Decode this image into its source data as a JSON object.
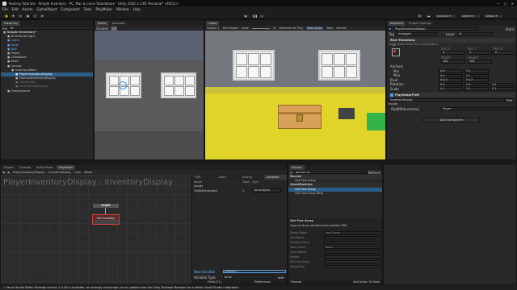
{
  "window": {
    "title": "Hutong Tutorials - Simple Inventory - PC, Mac & Linux Standalone - Unity 2020.3.13f1 Personal* <DX11>"
  },
  "menu": [
    "File",
    "Edit",
    "Assets",
    "GameObject",
    "Component",
    "Tools",
    "PlayMaker",
    "Window",
    "Help"
  ],
  "toolbar": {
    "account": "Account",
    "layers": "Layers",
    "layout": "Layout"
  },
  "hierarchy": {
    "tab": "Hierarchy",
    "search_placeholder": "All",
    "rows": [
      {
        "label": "Simple Inventory*",
        "depth": 0,
        "style": "bold"
      },
      {
        "label": "Directional Light",
        "depth": 1,
        "style": ""
      },
      {
        "label": "Clone",
        "depth": 1,
        "style": "blue"
      },
      {
        "label": "Table",
        "depth": 1,
        "style": "blue"
      },
      {
        "label": "Doll",
        "depth": 1,
        "style": "blue"
      },
      {
        "label": "Player",
        "depth": 1,
        "style": ""
      },
      {
        "label": "ChestBase",
        "depth": 1,
        "style": ""
      },
      {
        "label": "Walls",
        "depth": 1,
        "style": ""
      },
      {
        "label": "Canvas",
        "depth": 1,
        "style": ""
      },
      {
        "label": "InventoryMenu",
        "depth": 2,
        "style": ""
      },
      {
        "label": "PlayerInventoryDisplay",
        "depth": 3,
        "style": "sel"
      },
      {
        "label": "ExternalInventoryDisplay",
        "depth": 3,
        "style": ""
      },
      {
        "label": "Placeholder",
        "depth": 3,
        "style": "dim"
      },
      {
        "label": "SecondHandDisplay",
        "depth": 3,
        "style": "dim"
      },
      {
        "label": "EventSystem",
        "depth": 1,
        "style": ""
      }
    ]
  },
  "scene": {
    "tabs": [
      "Scene",
      "Animator"
    ],
    "shading": "Shaded",
    "mode": "2D"
  },
  "game": {
    "tab": "Game",
    "display": "Display 1",
    "aspect": "16:9 Aspect",
    "scale": "Scale",
    "scale_value": "1x",
    "options": [
      "Maximize On Play",
      "Mute Audio",
      "Stats",
      "Gizmos"
    ]
  },
  "inspector": {
    "tabs": [
      "Inspector",
      "Project Settings"
    ],
    "object_name": "PlayerInventoryDisplay",
    "static": "Static",
    "tag_label": "Tag",
    "tag": "Untagged",
    "layer_label": "Layer",
    "layer": "UI",
    "rect_transform": "Rect Transform",
    "driven_note": "Some values driven by InventoryMenu.",
    "anchor_mode": "left",
    "pos_labels": [
      "Pos X",
      "Pos Y",
      "Pos Z"
    ],
    "pos_values": [
      "0",
      "0",
      "0"
    ],
    "size_labels": [
      "Width",
      "Height"
    ],
    "size_values": [
      "100",
      "100"
    ],
    "anchors": "Anchors",
    "min_label": "Min",
    "min_values": [
      "X 0",
      "Y 1"
    ],
    "max_label": "Max",
    "max_values": [
      "X 0",
      "Y 1"
    ],
    "pivot_label": "Pivot",
    "pivot_values": [
      "X 0.5",
      "Y 0.5"
    ],
    "rotation_label": "Rotation",
    "rotation_values": [
      "X 0",
      "Y 0",
      "Z 0"
    ],
    "scale_label": "Scale",
    "scale_values": [
      "X 1",
      "Y 1",
      "Z 1"
    ],
    "fsm_header": "PlayMakerFSM",
    "fsm_name": "InventoryDisplay",
    "edit": "Edit",
    "inputs": "Inputs",
    "obj_inventory_label": "ObjWithInventory",
    "obj_inventory_value": "Player",
    "add_component": "Add Component"
  },
  "bottom_tabs": [
    "Project",
    "Console",
    "Audio Mixer",
    "PlayMaker"
  ],
  "playmaker": {
    "breadcrumb": [
      "PlayerInventoryDisplay",
      "InventoryDisplay",
      "Lock",
      "Select"
    ],
    "title": "PlayerInventoryDisplay : InventoryDisplay",
    "start": "START",
    "state": "Get Inventory",
    "panel_tabs": [
      "FSM",
      "State",
      "Events",
      "Variables"
    ],
    "var_headers": [
      "Name",
      "Used",
      "Type"
    ],
    "var_groups": [
      "Inputs"
    ],
    "vars": [
      {
        "name": "ObjWithInventory",
        "used": "1",
        "type": "GameObject"
      }
    ],
    "new_variable_label": "New Variable",
    "new_variable_value": "inventory",
    "variable_type_label": "Variable Type",
    "variable_type_value": "Array",
    "add": "Add",
    "bottom": [
      "Hints [F1]",
      "Preferences"
    ]
  },
  "actions": {
    "tab": "Actions",
    "search": "get fsm arr",
    "refresh": "Refresh",
    "sections": [
      {
        "header": "Recent",
        "items": [
          "Get Fsm Array"
        ]
      },
      {
        "header": "StateMachine",
        "items": [
          "Get Fsm Array",
          "Get Fsm Array Item"
        ]
      }
    ],
    "selected": "Get Fsm Array",
    "detail_title": "Get Fsm Array",
    "detail_desc": "Copy an Array Variable from another FSM.",
    "detail_fields": [
      {
        "label": "Game Object",
        "value": "Use Owner"
      },
      {
        "label": "Fsm Name",
        "value": ""
      },
      {
        "label": "Variable Name",
        "value": ""
      },
      {
        "label": "Store Value",
        "value": "None"
      },
      {
        "label": "Copy Values",
        "value": ""
      },
      {
        "label": "Enable",
        "value": ""
      },
      {
        "label": "Get Fsm Array",
        "value": ""
      },
      {
        "label": "Everything",
        "value": ""
      }
    ],
    "preview": "Preview",
    "add_to_state": "Add Action To State"
  },
  "status": {
    "text": "Visual Studio Editor Package version 2.0.16 is available, we strongly encourage you to update from the Unity Package Manager for a better Visual Studio integration"
  },
  "colors": {
    "selection": "#2c5d87",
    "accent": "#4f9de8",
    "error": "#d04040"
  }
}
